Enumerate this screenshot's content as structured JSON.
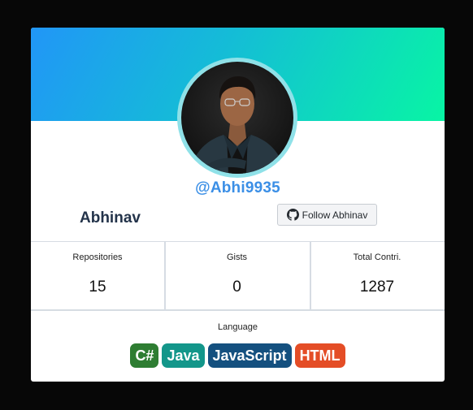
{
  "profile": {
    "handle": "@Abhi9935",
    "name": "Abhinav",
    "follow_label": "Follow Abhinav"
  },
  "stats": [
    {
      "label": "Repositories",
      "value": "15"
    },
    {
      "label": "Gists",
      "value": "0"
    },
    {
      "label": "Total Contri.",
      "value": "1287"
    }
  ],
  "languages": {
    "label": "Language",
    "items": [
      {
        "name": "C#",
        "color": "#2e7d32"
      },
      {
        "name": "Java",
        "color": "#13968a"
      },
      {
        "name": "JavaScript",
        "color": "#14507f"
      },
      {
        "name": "HTML",
        "color": "#e44d26"
      }
    ]
  },
  "colors": {
    "banner_start": "#2196f7",
    "banner_end": "#08f5a4",
    "handle": "#3b8fe6"
  },
  "icons": {
    "follow": "github-icon"
  }
}
